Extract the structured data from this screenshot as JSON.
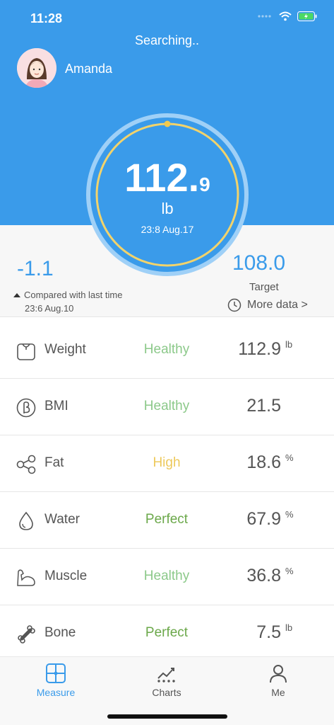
{
  "status_bar": {
    "time": "11:28"
  },
  "header": {
    "status_text": "Searching..",
    "user_name": "Amanda"
  },
  "gauge": {
    "weight_int": "112.",
    "weight_dec": "9",
    "unit": "lb",
    "timestamp": "23:8 Aug.17"
  },
  "comparison": {
    "delta": "-1.1",
    "label": "Compared with last time",
    "time": "23:6 Aug.10"
  },
  "target": {
    "value": "108.0",
    "label": "Target",
    "more_data": "More data >"
  },
  "metrics": [
    {
      "name": "Weight",
      "status": "Healthy",
      "value": "112.9",
      "unit": "lb",
      "icon": "scale-icon",
      "status_color": "#8cc98a"
    },
    {
      "name": "BMI",
      "status": "Healthy",
      "value": "21.5",
      "unit": "",
      "icon": "bmi-icon",
      "status_color": "#8cc98a"
    },
    {
      "name": "Fat",
      "status": "High",
      "value": "18.6",
      "unit": "%",
      "icon": "fat-icon",
      "status_color": "#edc95c"
    },
    {
      "name": "Water",
      "status": "Perfect",
      "value": "67.9",
      "unit": "%",
      "icon": "water-drop-icon",
      "status_color": "#6ba84a"
    },
    {
      "name": "Muscle",
      "status": "Healthy",
      "value": "36.8",
      "unit": "%",
      "icon": "muscle-icon",
      "status_color": "#8cc98a"
    },
    {
      "name": "Bone",
      "status": "Perfect",
      "value": "7.5",
      "unit": "lb",
      "icon": "bone-icon",
      "status_color": "#6ba84a"
    }
  ],
  "tabs": [
    {
      "label": "Measure",
      "icon": "measure-icon",
      "active": true
    },
    {
      "label": "Charts",
      "icon": "charts-icon",
      "active": false
    },
    {
      "label": "Me",
      "icon": "person-icon",
      "active": false
    }
  ],
  "colors": {
    "primary": "#3a9bea",
    "gauge_ring": "#f2d36b",
    "healthy": "#8cc98a",
    "high": "#edc95c",
    "perfect": "#6ba84a"
  }
}
